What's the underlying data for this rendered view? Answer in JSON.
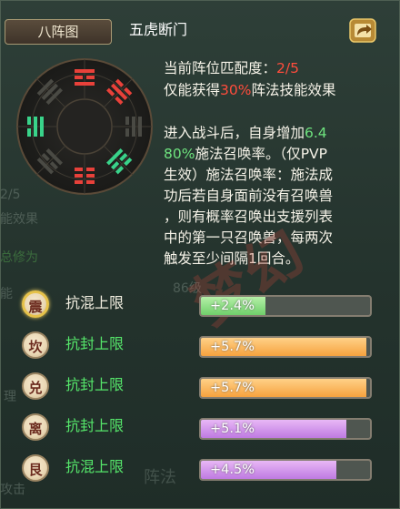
{
  "header": {
    "tab_label": "八阵图",
    "formation_name": "五虎断门"
  },
  "bagua_center": "",
  "ghost": {
    "a": "2/5",
    "b": "能效果",
    "c": "总修为",
    "d": "86级",
    "e": "能",
    "f": "理",
    "g": "阵法",
    "h": "攻击"
  },
  "info": {
    "match_label": "当前阵位匹配度：",
    "match_value": "2/5",
    "only_prefix": "仅能获得",
    "only_pct": "30%",
    "only_suffix": "阵法技能效果",
    "l1a": "进入战斗后，自身增加",
    "l1b": "6.4",
    "l2a": "80%",
    "l2b": "施法召唤率。（仅PVP",
    "l3": "生效）施法召唤率：施法成",
    "l4": "功后若自身面前没有召唤兽",
    "l5": "，则有概率召唤出支援列表",
    "l6": "中的第一只召唤兽，每两次",
    "l7": "触发至少间隔1回合。"
  },
  "watermark": "梦幻",
  "rows": [
    {
      "trigram": "震",
      "label": "抗混上限",
      "value": "+2.4%",
      "fill": 0.38,
      "color": "green"
    },
    {
      "trigram": "坎",
      "label": "抗封上限",
      "value": "+5.7%",
      "fill": 0.98,
      "color": "orange"
    },
    {
      "trigram": "兑",
      "label": "抗封上限",
      "value": "+5.7%",
      "fill": 0.98,
      "color": "orange"
    },
    {
      "trigram": "离",
      "label": "抗封上限",
      "value": "+5.1%",
      "fill": 0.86,
      "color": "purple"
    },
    {
      "trigram": "艮",
      "label": "抗混上限",
      "value": "+4.5%",
      "fill": 0.8,
      "color": "purple"
    }
  ],
  "colors": {
    "label_active": "#f2eee0",
    "label_green": "#55e56a",
    "red": "#ff4c3c",
    "green_text": "#6ee27e"
  }
}
